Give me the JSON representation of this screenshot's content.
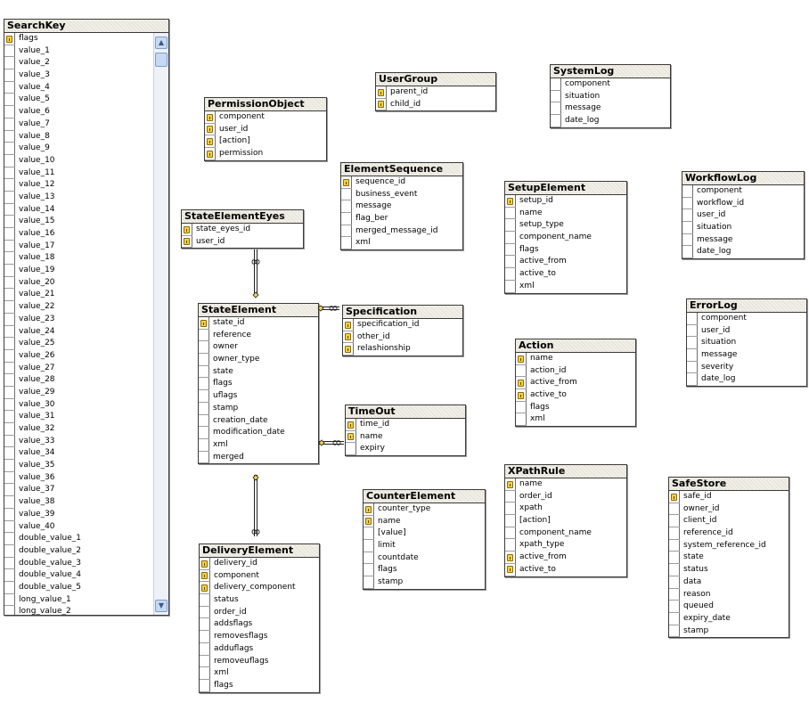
{
  "tables": [
    {
      "id": "searchkey",
      "title": "SearchKey",
      "rows": [
        {
          "name": "flags",
          "key": true
        },
        {
          "name": "value_1"
        },
        {
          "name": "value_2"
        },
        {
          "name": "value_3"
        },
        {
          "name": "value_4"
        },
        {
          "name": "value_5"
        },
        {
          "name": "value_6"
        },
        {
          "name": "value_7"
        },
        {
          "name": "value_8"
        },
        {
          "name": "value_9"
        },
        {
          "name": "value_10"
        },
        {
          "name": "value_11"
        },
        {
          "name": "value_12"
        },
        {
          "name": "value_13"
        },
        {
          "name": "value_14"
        },
        {
          "name": "value_15"
        },
        {
          "name": "value_16"
        },
        {
          "name": "value_17"
        },
        {
          "name": "value_18"
        },
        {
          "name": "value_19"
        },
        {
          "name": "value_20"
        },
        {
          "name": "value_21"
        },
        {
          "name": "value_22"
        },
        {
          "name": "value_23"
        },
        {
          "name": "value_24"
        },
        {
          "name": "value_25"
        },
        {
          "name": "value_26"
        },
        {
          "name": "value_27"
        },
        {
          "name": "value_28"
        },
        {
          "name": "value_29"
        },
        {
          "name": "value_30"
        },
        {
          "name": "value_31"
        },
        {
          "name": "value_32"
        },
        {
          "name": "value_33"
        },
        {
          "name": "value_34"
        },
        {
          "name": "value_35"
        },
        {
          "name": "value_36"
        },
        {
          "name": "value_37"
        },
        {
          "name": "value_38"
        },
        {
          "name": "value_39"
        },
        {
          "name": "value_40"
        },
        {
          "name": "double_value_1"
        },
        {
          "name": "double_value_2"
        },
        {
          "name": "double_value_3"
        },
        {
          "name": "double_value_4"
        },
        {
          "name": "double_value_5"
        },
        {
          "name": "long_value_1"
        },
        {
          "name": "long_value_2"
        }
      ]
    },
    {
      "id": "permissionobject",
      "title": "PermissionObject",
      "rows": [
        {
          "name": "component",
          "key": true
        },
        {
          "name": "user_id",
          "key": true
        },
        {
          "name": "[action]",
          "key": true
        },
        {
          "name": "permission",
          "key": true
        }
      ]
    },
    {
      "id": "usergroup",
      "title": "UserGroup",
      "rows": [
        {
          "name": "parent_id",
          "key": true
        },
        {
          "name": "child_id",
          "key": true
        }
      ]
    },
    {
      "id": "systemlog",
      "title": "SystemLog",
      "rows": [
        {
          "name": "component"
        },
        {
          "name": "situation"
        },
        {
          "name": "message"
        },
        {
          "name": "date_log"
        }
      ]
    },
    {
      "id": "elementsequence",
      "title": "ElementSequence",
      "rows": [
        {
          "name": "sequence_id",
          "key": true
        },
        {
          "name": "business_event"
        },
        {
          "name": "message"
        },
        {
          "name": "flag_ber"
        },
        {
          "name": "merged_message_id"
        },
        {
          "name": "xml"
        }
      ]
    },
    {
      "id": "setupelement",
      "title": "SetupElement",
      "rows": [
        {
          "name": "setup_id",
          "key": true
        },
        {
          "name": "name"
        },
        {
          "name": "setup_type"
        },
        {
          "name": "component_name"
        },
        {
          "name": "flags"
        },
        {
          "name": "active_from"
        },
        {
          "name": "active_to"
        },
        {
          "name": "xml"
        }
      ]
    },
    {
      "id": "workflowlog",
      "title": "WorkflowLog",
      "rows": [
        {
          "name": "component"
        },
        {
          "name": "workflow_id"
        },
        {
          "name": "user_id"
        },
        {
          "name": "situation"
        },
        {
          "name": "message"
        },
        {
          "name": "date_log"
        }
      ]
    },
    {
      "id": "stateelementeyes",
      "title": "StateElementEyes",
      "rows": [
        {
          "name": "state_eyes_id",
          "key": true
        },
        {
          "name": "user_id",
          "key": true
        }
      ]
    },
    {
      "id": "stateelement",
      "title": "StateElement",
      "rows": [
        {
          "name": "state_id",
          "key": true
        },
        {
          "name": "reference"
        },
        {
          "name": "owner"
        },
        {
          "name": "owner_type"
        },
        {
          "name": "state"
        },
        {
          "name": "flags"
        },
        {
          "name": "uflags"
        },
        {
          "name": "stamp"
        },
        {
          "name": "creation_date"
        },
        {
          "name": "modification_date"
        },
        {
          "name": "xml"
        },
        {
          "name": "merged"
        }
      ]
    },
    {
      "id": "specification",
      "title": "Specification",
      "rows": [
        {
          "name": "specification_id",
          "key": true
        },
        {
          "name": "other_id",
          "key": true
        },
        {
          "name": "relashionship",
          "key": true
        }
      ]
    },
    {
      "id": "errorlog",
      "title": "ErrorLog",
      "rows": [
        {
          "name": "component"
        },
        {
          "name": "user_id"
        },
        {
          "name": "situation"
        },
        {
          "name": "message"
        },
        {
          "name": "severity"
        },
        {
          "name": "date_log"
        }
      ]
    },
    {
      "id": "action",
      "title": "Action",
      "rows": [
        {
          "name": "name",
          "key": true
        },
        {
          "name": "action_id"
        },
        {
          "name": "active_from",
          "key": true
        },
        {
          "name": "active_to",
          "key": true
        },
        {
          "name": "flags"
        },
        {
          "name": "xml"
        }
      ]
    },
    {
      "id": "timeout",
      "title": "TimeOut",
      "rows": [
        {
          "name": "time_id",
          "key": true
        },
        {
          "name": "name",
          "key": true
        },
        {
          "name": "expiry"
        }
      ]
    },
    {
      "id": "xpathrule",
      "title": "XPathRule",
      "rows": [
        {
          "name": "name",
          "key": true
        },
        {
          "name": "order_id"
        },
        {
          "name": "xpath"
        },
        {
          "name": "[action]"
        },
        {
          "name": "component_name"
        },
        {
          "name": "xpath_type"
        },
        {
          "name": "active_from",
          "key": true
        },
        {
          "name": "active_to",
          "key": true
        }
      ]
    },
    {
      "id": "counterelement",
      "title": "CounterElement",
      "rows": [
        {
          "name": "counter_type",
          "key": true
        },
        {
          "name": "name",
          "key": true
        },
        {
          "name": "[value]"
        },
        {
          "name": "limit"
        },
        {
          "name": "countdate"
        },
        {
          "name": "flags"
        },
        {
          "name": "stamp"
        }
      ]
    },
    {
      "id": "safestore",
      "title": "SafeStore",
      "rows": [
        {
          "name": "safe_id",
          "key": true
        },
        {
          "name": "owner_id"
        },
        {
          "name": "client_id"
        },
        {
          "name": "reference_id"
        },
        {
          "name": "system_reference_id"
        },
        {
          "name": "state"
        },
        {
          "name": "status"
        },
        {
          "name": "data"
        },
        {
          "name": "reason"
        },
        {
          "name": "queued"
        },
        {
          "name": "expiry_date"
        },
        {
          "name": "stamp"
        }
      ]
    },
    {
      "id": "deliveryelement",
      "title": "DeliveryElement",
      "rows": [
        {
          "name": "delivery_id",
          "key": true
        },
        {
          "name": "component",
          "key": true
        },
        {
          "name": "delivery_component",
          "key": true
        },
        {
          "name": "status"
        },
        {
          "name": "order_id"
        },
        {
          "name": "addsflags"
        },
        {
          "name": "removesflags"
        },
        {
          "name": "adduflags"
        },
        {
          "name": "removeuflags"
        },
        {
          "name": "xml"
        },
        {
          "name": "flags"
        }
      ]
    }
  ],
  "scrollbar": {
    "up_icon": "▲",
    "down_icon": "▼"
  },
  "colors": {
    "key_icon": "#f7d14a",
    "border": "#3a3a3a",
    "title_bg": "#f1efe6"
  }
}
